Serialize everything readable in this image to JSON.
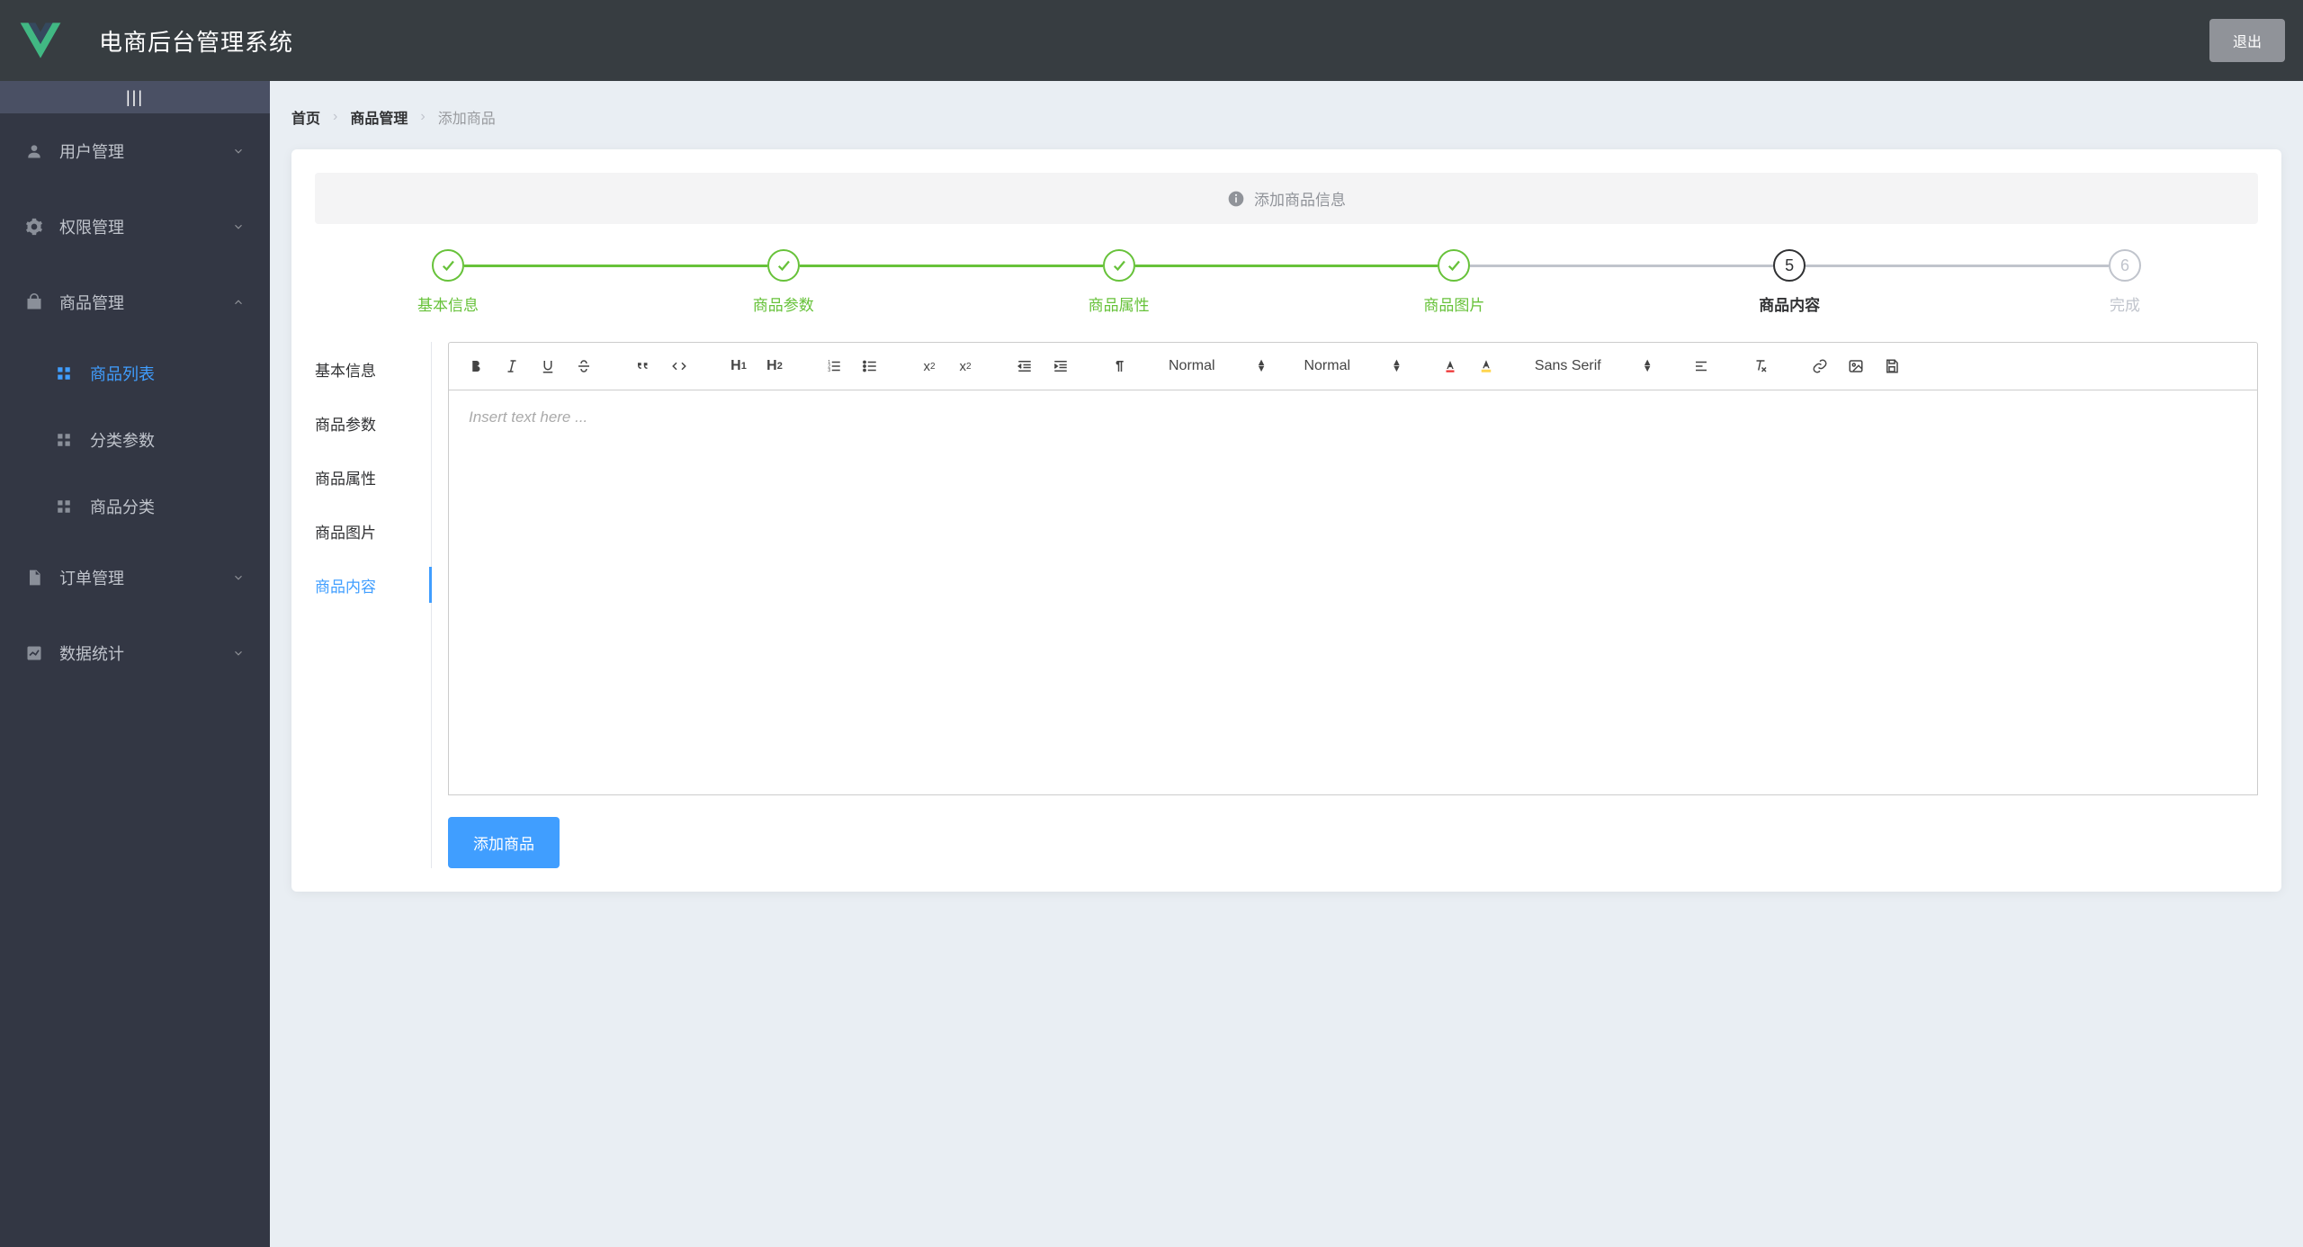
{
  "header": {
    "app_title": "电商后台管理系统",
    "logout_label": "退出"
  },
  "sidebar": {
    "toggle_glyph": "|||",
    "items": [
      {
        "label": "用户管理",
        "expanded": false
      },
      {
        "label": "权限管理",
        "expanded": false
      },
      {
        "label": "商品管理",
        "expanded": true,
        "children": [
          {
            "label": "商品列表",
            "active": true
          },
          {
            "label": "分类参数",
            "active": false
          },
          {
            "label": "商品分类",
            "active": false
          }
        ]
      },
      {
        "label": "订单管理",
        "expanded": false
      },
      {
        "label": "数据统计",
        "expanded": false
      }
    ]
  },
  "breadcrumb": {
    "items": [
      "首页",
      "商品管理",
      "添加商品"
    ]
  },
  "alert": {
    "text": "添加商品信息"
  },
  "steps": {
    "current_index": 4,
    "items": [
      {
        "title": "基本信息",
        "status": "finish"
      },
      {
        "title": "商品参数",
        "status": "finish"
      },
      {
        "title": "商品属性",
        "status": "finish"
      },
      {
        "title": "商品图片",
        "status": "finish"
      },
      {
        "title": "商品内容",
        "status": "process",
        "number": "5"
      },
      {
        "title": "完成",
        "status": "wait",
        "number": "6"
      }
    ]
  },
  "tabs": {
    "items": [
      {
        "label": "基本信息",
        "active": false
      },
      {
        "label": "商品参数",
        "active": false
      },
      {
        "label": "商品属性",
        "active": false
      },
      {
        "label": "商品图片",
        "active": false
      },
      {
        "label": "商品内容",
        "active": true
      }
    ]
  },
  "editor": {
    "placeholder": "Insert text here ...",
    "size_select": "Normal",
    "header_select": "Normal",
    "font_select": "Sans Serif"
  },
  "buttons": {
    "add_product": "添加商品"
  }
}
